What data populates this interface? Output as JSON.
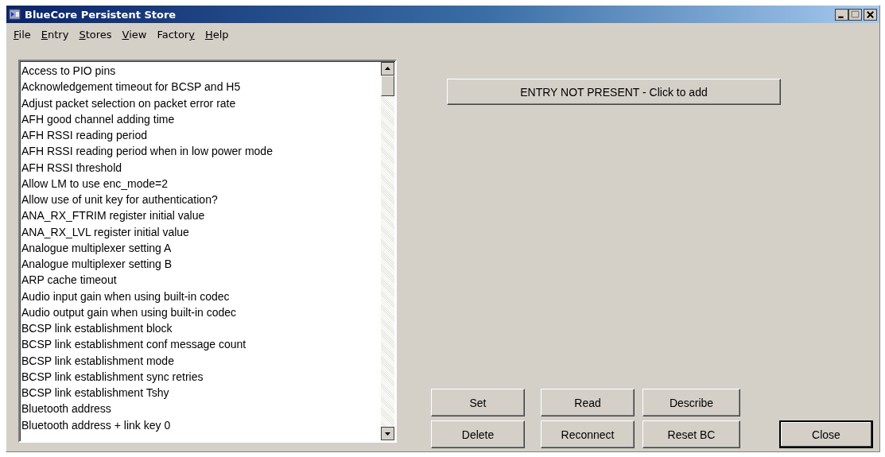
{
  "window": {
    "title": "BlueCore Persistent Store"
  },
  "menu": [
    {
      "key": "F",
      "after": "ile"
    },
    {
      "key": "E",
      "after": "ntry"
    },
    {
      "key": "S",
      "after": "tores"
    },
    {
      "key": "V",
      "after": "iew"
    },
    {
      "before": "Factor",
      "key": "y"
    },
    {
      "key": "H",
      "after": "elp"
    }
  ],
  "entries": [
    "Access to PIO pins",
    "Acknowledgement timeout for BCSP and H5",
    "Adjust packet selection on packet error rate",
    "AFH good channel adding time",
    "AFH RSSI reading period",
    "AFH RSSI reading period when in low power mode",
    "AFH RSSI threshold",
    "Allow LM to use enc_mode=2",
    "Allow use of unit key for authentication?",
    "ANA_RX_FTRIM register initial value",
    "ANA_RX_LVL register initial value",
    "Analogue multiplexer setting A",
    "Analogue multiplexer setting B",
    "ARP cache timeout",
    "Audio input gain when using built-in codec",
    "Audio output gain when using built-in codec",
    "BCSP link establishment block",
    "BCSP link establishment conf message count",
    "BCSP link establishment mode",
    "BCSP link establishment sync retries",
    "BCSP link establishment Tshy",
    "Bluetooth address",
    "Bluetooth address + link key 0"
  ],
  "entry_button": "ENTRY NOT PRESENT - Click to add",
  "buttons": [
    {
      "label": "Set",
      "default": false
    },
    {
      "label": "Read",
      "default": false
    },
    {
      "label": "Describe",
      "default": false
    },
    {
      "label": "Delete",
      "default": false
    },
    {
      "label": "Reconnect",
      "default": false
    },
    {
      "label": "Reset BC",
      "default": false
    }
  ],
  "close_button": {
    "label": "Close",
    "default": true
  }
}
